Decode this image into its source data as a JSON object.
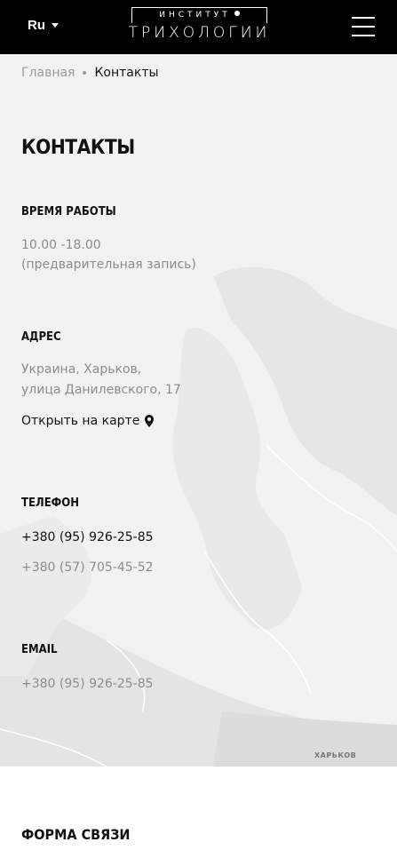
{
  "header": {
    "language": "Ru",
    "logo_top": "ИНСТИТУТ",
    "logo_bottom": "ТРИХОЛОГИИ"
  },
  "breadcrumb": {
    "home": "Главная",
    "current": "Контакты"
  },
  "page_title": "КОНТАКТЫ",
  "hours": {
    "heading": "ВРЕМЯ РАБОТЫ",
    "time": "10.00 -18.00",
    "note": "(предварительная запись)"
  },
  "address": {
    "heading": "АДРЕС",
    "line1": "Украина, Харьков,",
    "line2": "улица Данилевского, 17",
    "map_link": "Открыть на карте"
  },
  "phone": {
    "heading": "ТЕЛЕФОН",
    "primary": "+380 (95) 926-25-85",
    "secondary": "+380 (57) 705-45-52"
  },
  "email": {
    "heading": "EMAIL",
    "value": "+380 (95) 926-25-85"
  },
  "map": {
    "city_label": "ХАРЬКОВ"
  },
  "form": {
    "title": "ФОРМА СВЯЗИ"
  }
}
